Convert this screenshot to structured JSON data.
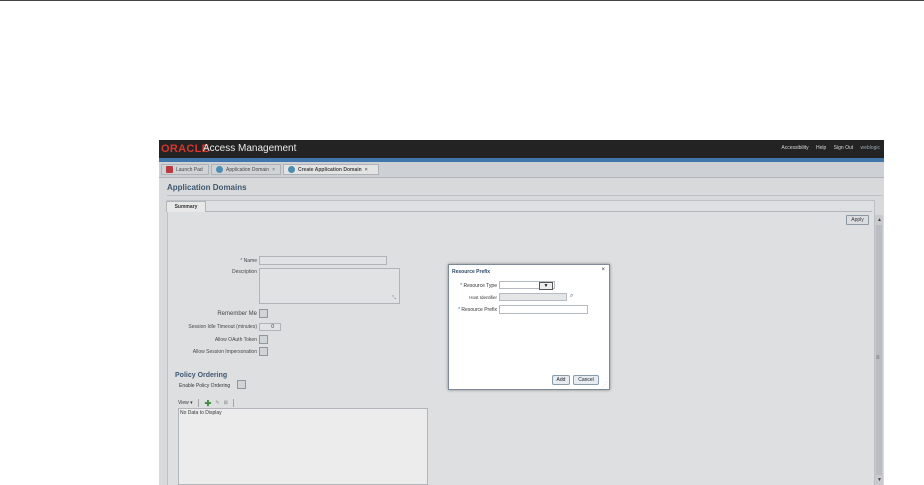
{
  "header": {
    "logo": "ORACLE",
    "title": "Access Management",
    "links": [
      "Accessibility",
      "Help",
      "Sign Out"
    ],
    "user": "weblogic"
  },
  "tabs": [
    {
      "label": "Launch Pad",
      "closable": false,
      "active": false,
      "icon": "launch-pad-icon"
    },
    {
      "label": "Application Domain",
      "closable": true,
      "active": false,
      "icon": "domain-icon"
    },
    {
      "label": "Create Application Domain",
      "closable": true,
      "active": true,
      "icon": "domain-icon"
    }
  ],
  "page": {
    "title": "Application Domains",
    "subtab": "Summary",
    "apply": "Apply"
  },
  "form": {
    "name_label": "Name",
    "description_label": "Description",
    "remember_label": "Remember Me",
    "session_idle_label": "Session Idle Timeout (minutes)",
    "session_idle_value": "0",
    "oauth_label": "Allow OAuth Token",
    "impersonation_label": "Allow Session Impersonation"
  },
  "policy": {
    "title": "Policy Ordering",
    "enable_label": "Enable Policy Ordering",
    "view_label": "View",
    "empty_text": "No Data to Display"
  },
  "dialog": {
    "title": "Resource Prefix",
    "resource_type_label": "Resource Type",
    "host_identifier_label": "Host Identifier",
    "resource_prefix_label": "Resource Prefix",
    "add": "Add",
    "cancel": "Cancel"
  },
  "colors": {
    "accent_blue": "#2e6fb0",
    "oracle_red": "#e2231a",
    "header_bg": "#0a0a0a"
  }
}
